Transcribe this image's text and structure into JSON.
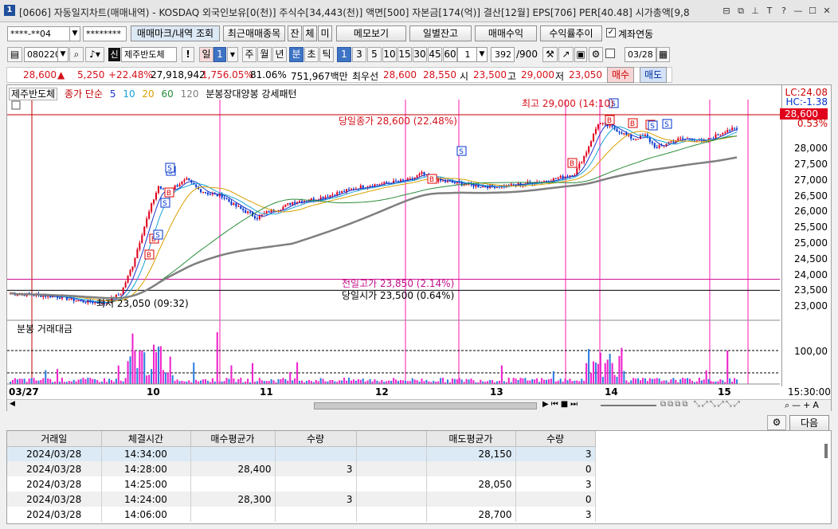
{
  "window": {
    "num": "1",
    "title": "[0606] 자동일지차트(매매내역) - KOSDAQ 외국인보유[0(천)] 주식수[34,443(천)] 액면[500] 자본금[174(억)] 결산[12월] EPS[706] PER[40.48] 시가총액[9,8"
  },
  "toolbar1": {
    "account": "****-**04",
    "password": "********",
    "btn_mark": "매매마크/내역 조회",
    "btn_recent": "최근매매종목",
    "btn_jan": "잔",
    "btn_che": "체",
    "btn_mi": "미",
    "btn_memo": "메모보기",
    "btn_daily": "일별잔고",
    "btn_profit": "매매수익",
    "btn_trend": "수익률추이",
    "chk_link": "계좌연동"
  },
  "toolbar2": {
    "code": "080220",
    "badge": "신",
    "name": "제주반도체",
    "excl": "!",
    "period_il": "일",
    "period_1": "1",
    "ju": "주",
    "wol": "월",
    "nyeon": "년",
    "bun": "분",
    "cho": "초",
    "tik": "틱",
    "intervals": [
      "1",
      "3",
      "5",
      "10",
      "15",
      "30",
      "45",
      "60"
    ],
    "count": "1",
    "span": "392",
    "total": "/900",
    "date": "03/28"
  },
  "quote": {
    "price": "28,600",
    "arrow": "▲",
    "change": "5,250",
    "rate": "+22.48%",
    "volume": "27,918,942",
    "vol_rate": "1,756.05%",
    "ratio": "81.06%",
    "amount": "751,967백만",
    "best_label": "최우선",
    "ask": "28,600",
    "bid": "28,550",
    "open_label": "시",
    "open": "23,500",
    "high_label": "고",
    "high": "29,000",
    "low_label": "저",
    "low": "23,050",
    "buy": "매수",
    "sell": "매도"
  },
  "legend": {
    "name": "제주반도체",
    "ma_label": "종가 단순",
    "ma5": "5",
    "ma10": "10",
    "ma20": "20",
    "ma60": "60",
    "ma120": "120",
    "pattern": "분봉장대양봉 강세패턴",
    "vol_label": "분봉 거래대금"
  },
  "annotations": {
    "high": "최고 29,000 (14:10)",
    "close": "당일종가 28,600 (22.48%)",
    "prev_high": "전일고가 23,850 (2.14%)",
    "prev_open": "당일시가 23,500 (0.64%)",
    "low": "최저 23,050 (09:32)"
  },
  "yaxis": {
    "lc": "LC:24.08",
    "hc": "HC:-1.38",
    "cur": "28,600",
    "pct": "0.53%",
    "ticks": [
      "28,000",
      "27,500",
      "27,000",
      "26,500",
      "26,000",
      "25,500",
      "25,000",
      "24,500",
      "24,000",
      "23,500",
      "23,000"
    ],
    "vol_tick": "100,00"
  },
  "xaxis": {
    "labels": [
      "03/27",
      "10",
      "11",
      "12",
      "13",
      "14",
      "15"
    ],
    "time": "15:30:00"
  },
  "colors": {
    "up": "#e0001c",
    "down": "#0033cc",
    "ma5": "#1a35c9",
    "ma10": "#17a2d4",
    "ma20": "#d9a000",
    "ma60": "#2a8c3a",
    "ma120": "#7f7f7f",
    "pink": "#ff66cc",
    "vol": "#ee22cc"
  },
  "grid": {
    "next": "다음",
    "headers": [
      "거래일",
      "체결시간",
      "매수평균가",
      "수량",
      "",
      "매도평균가",
      "수량"
    ],
    "rows": [
      [
        "2024/03/28",
        "14:34:00",
        "",
        "",
        "",
        "28,150",
        "3"
      ],
      [
        "2024/03/28",
        "14:28:00",
        "28,400",
        "3",
        "",
        "",
        "0"
      ],
      [
        "2024/03/28",
        "14:25:00",
        "",
        "",
        "",
        "28,050",
        "3"
      ],
      [
        "2024/03/28",
        "14:24:00",
        "28,300",
        "3",
        "",
        "",
        "0"
      ],
      [
        "2024/03/28",
        "14:06:00",
        "",
        "",
        "",
        "28,700",
        "3"
      ]
    ]
  },
  "chart_data": {
    "type": "candlestick",
    "title": "",
    "x_range": [
      "03/27 15:00",
      "03/28 15:30"
    ],
    "ylim": [
      22800,
      29500
    ],
    "close_series": [
      [
        0,
        23400
      ],
      [
        10,
        23350
      ],
      [
        20,
        23300
      ],
      [
        30,
        23150
      ],
      [
        40,
        23100
      ],
      [
        47,
        23400
      ],
      [
        52,
        24300
      ],
      [
        56,
        25300
      ],
      [
        60,
        26200
      ],
      [
        63,
        26800
      ],
      [
        66,
        26600
      ],
      [
        70,
        26800
      ],
      [
        75,
        27000
      ],
      [
        80,
        26700
      ],
      [
        85,
        26550
      ],
      [
        90,
        26500
      ],
      [
        95,
        26200
      ],
      [
        100,
        26000
      ],
      [
        105,
        25800
      ],
      [
        110,
        26000
      ],
      [
        115,
        26100
      ],
      [
        120,
        26300
      ],
      [
        130,
        26400
      ],
      [
        140,
        26600
      ],
      [
        150,
        26800
      ],
      [
        160,
        26900
      ],
      [
        170,
        27000
      ],
      [
        175,
        27200
      ],
      [
        180,
        27000
      ],
      [
        190,
        26900
      ],
      [
        200,
        26800
      ],
      [
        210,
        26800
      ],
      [
        220,
        26900
      ],
      [
        230,
        27000
      ],
      [
        240,
        27200
      ],
      [
        245,
        27900
      ],
      [
        250,
        28800
      ],
      [
        255,
        28700
      ],
      [
        260,
        28500
      ],
      [
        265,
        28300
      ],
      [
        270,
        28400
      ],
      [
        275,
        28000
      ],
      [
        280,
        28200
      ],
      [
        285,
        28300
      ],
      [
        290,
        28300
      ],
      [
        295,
        28200
      ],
      [
        300,
        28400
      ],
      [
        305,
        28600
      ]
    ],
    "volume_peak": "100,00"
  }
}
